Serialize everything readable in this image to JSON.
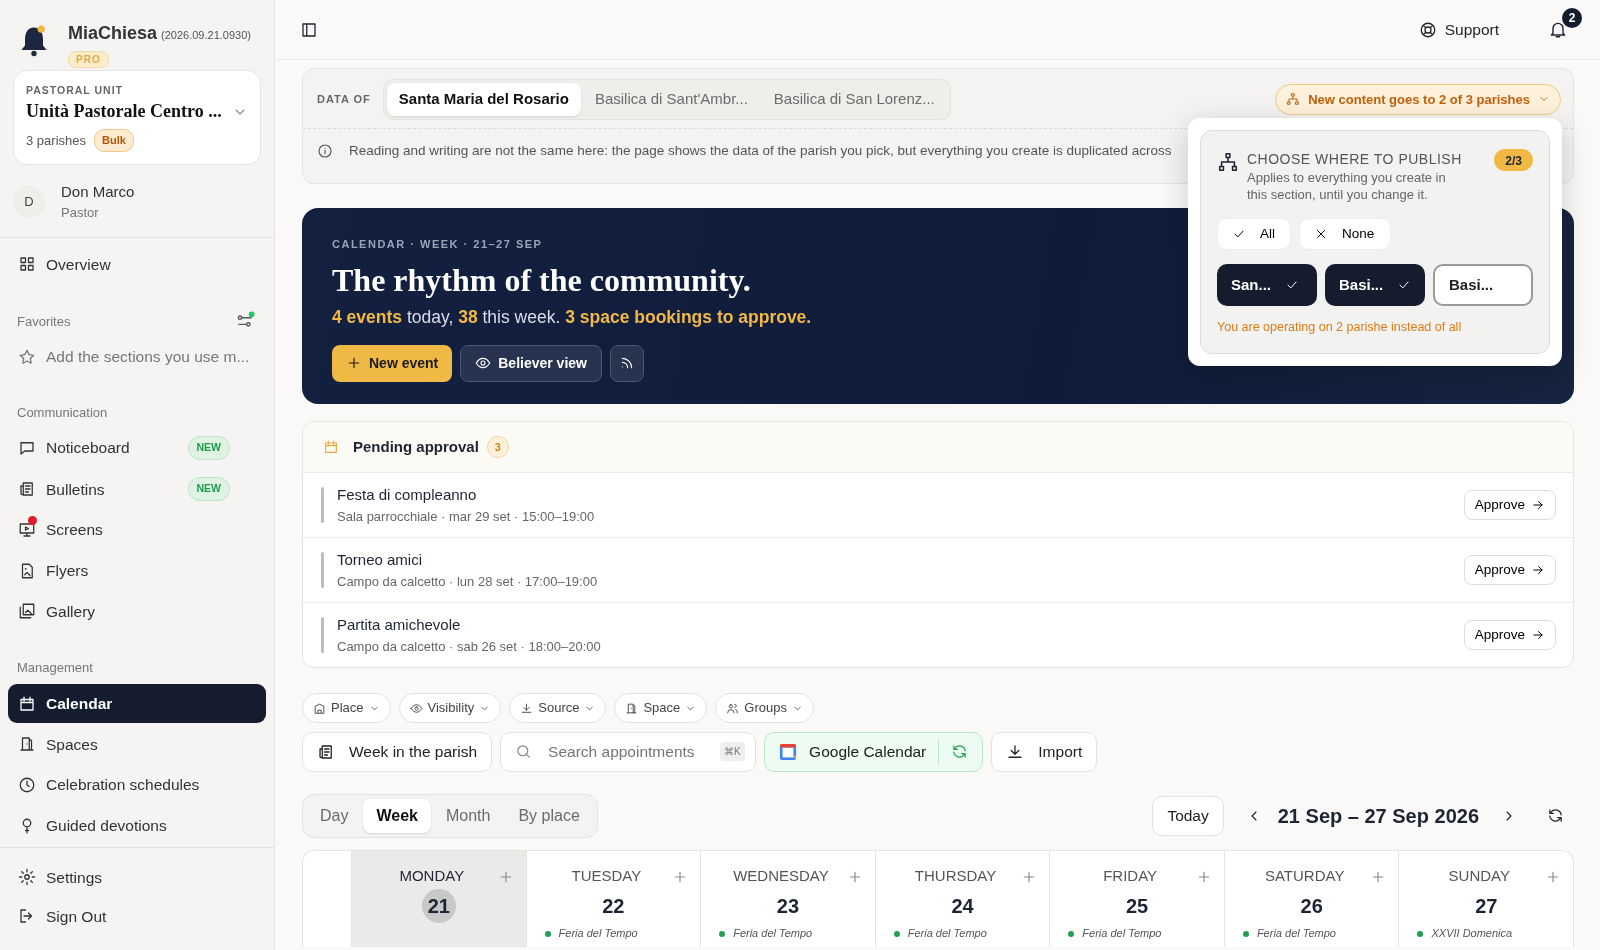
{
  "app": {
    "name": "MiaChiesa",
    "version": "(2026.09.21.0930)",
    "plan": "PRO"
  },
  "unit": {
    "label": "PASTORAL UNIT",
    "name": "Unità Pastorale Centro ...",
    "count": "3 parishes",
    "badge": "Bulk"
  },
  "user": {
    "initial": "D",
    "name": "Don Marco",
    "role": "Pastor"
  },
  "sidebar": {
    "sections": [
      {
        "items": [
          {
            "label": "Overview",
            "selected": false
          }
        ]
      },
      {
        "title": "Favorites",
        "hint": "Add the sections you use m..."
      },
      {
        "title": "Communication",
        "items": [
          {
            "label": "Noticeboard",
            "badge": "NEW",
            "alert": false,
            "selected": false
          },
          {
            "label": "Bulletins",
            "badge": "NEW",
            "alert": false,
            "selected": false
          },
          {
            "label": "Screens",
            "alert": true,
            "selected": false
          },
          {
            "label": "Flyers",
            "alert": false,
            "selected": false
          },
          {
            "label": "Gallery",
            "alert": false,
            "selected": false
          }
        ]
      },
      {
        "title": "Management",
        "items": [
          {
            "label": "Calendar",
            "selected": true
          },
          {
            "label": "Spaces",
            "selected": false
          },
          {
            "label": "Celebration schedules",
            "selected": false
          },
          {
            "label": "Guided devotions",
            "selected": false
          }
        ]
      }
    ],
    "footer": [
      {
        "label": "Settings",
        "selected": false
      },
      {
        "label": "Sign Out",
        "selected": false
      }
    ]
  },
  "topbar": {
    "support": "Support",
    "notifications": "2"
  },
  "data_of": {
    "label": "DATA OF",
    "tabs": [
      {
        "label": "Santa Maria del Rosario",
        "selected": true
      },
      {
        "label": "Basilica di Sant'Ambr...",
        "selected": false
      },
      {
        "label": "Basilica di San Lorenz...",
        "selected": false
      }
    ],
    "scope": "New content goes to 2 of 3 parishes",
    "info": "Reading and writing are not the same here: the page shows the data of the parish you pick, but everything you create is duplicated across"
  },
  "popover": {
    "title": "CHOOSE WHERE TO PUBLISH",
    "count": "2/3",
    "description": "Applies to everything you create in this section, until you change it.",
    "all": "All",
    "none": "None",
    "parishes": [
      {
        "label": "San...",
        "checked": true
      },
      {
        "label": "Basi...",
        "checked": true
      },
      {
        "label": "Basi...",
        "checked": false
      }
    ],
    "warning": "You are operating on 2 parishe instead of all"
  },
  "hero": {
    "eyebrow": "CALENDAR · WEEK · 21–27 SEP",
    "title": "The rhythm of the community.",
    "summary": "**4 events** today, **38** this week. **3 space bookings to approve.**",
    "new_event": "New event",
    "believer_view": "Believer view"
  },
  "pending": {
    "title": "Pending approval",
    "count": "3",
    "items": [
      {
        "title": "Festa di compleanno",
        "meta": "Sala parrocchiale · mar 29 set · 15:00–19:00",
        "action": "Approve"
      },
      {
        "title": "Torneo amici",
        "meta": "Campo da calcetto · lun 28 set · 17:00–19:00",
        "action": "Approve"
      },
      {
        "title": "Partita amichevole",
        "meta": "Campo da calcetto · sab 26 set · 18:00–20:00",
        "action": "Approve"
      }
    ]
  },
  "filters": [
    "Place",
    "Visibility",
    "Source",
    "Space",
    "Groups"
  ],
  "toolbar": {
    "week": "Week in the parish",
    "search_placeholder": "Search appointments",
    "shortcut": "⌘K",
    "google": "Google Calendar",
    "import": "Import"
  },
  "views": [
    {
      "label": "Day",
      "selected": false
    },
    {
      "label": "Week",
      "selected": true
    },
    {
      "label": "Month",
      "selected": false
    },
    {
      "label": "By place",
      "selected": false
    }
  ],
  "nav": {
    "today": "Today",
    "range": "21 Sep – 27 Sep 2026"
  },
  "days": [
    {
      "name": "MONDAY",
      "date": "21",
      "selected": true
    },
    {
      "name": "TUESDAY",
      "date": "22",
      "selected": false,
      "note": "Feria del Tempo"
    },
    {
      "name": "WEDNESDAY",
      "date": "23",
      "selected": false,
      "note": "Feria del Tempo"
    },
    {
      "name": "THURSDAY",
      "date": "24",
      "selected": false,
      "note": "Feria del Tempo"
    },
    {
      "name": "FRIDAY",
      "date": "25",
      "selected": false,
      "note": "Feria del Tempo"
    },
    {
      "name": "SATURDAY",
      "date": "26",
      "selected": false,
      "note": "Feria del Tempo"
    },
    {
      "name": "SUNDAY",
      "date": "27",
      "selected": false,
      "note": "XXVII Domenica"
    }
  ]
}
